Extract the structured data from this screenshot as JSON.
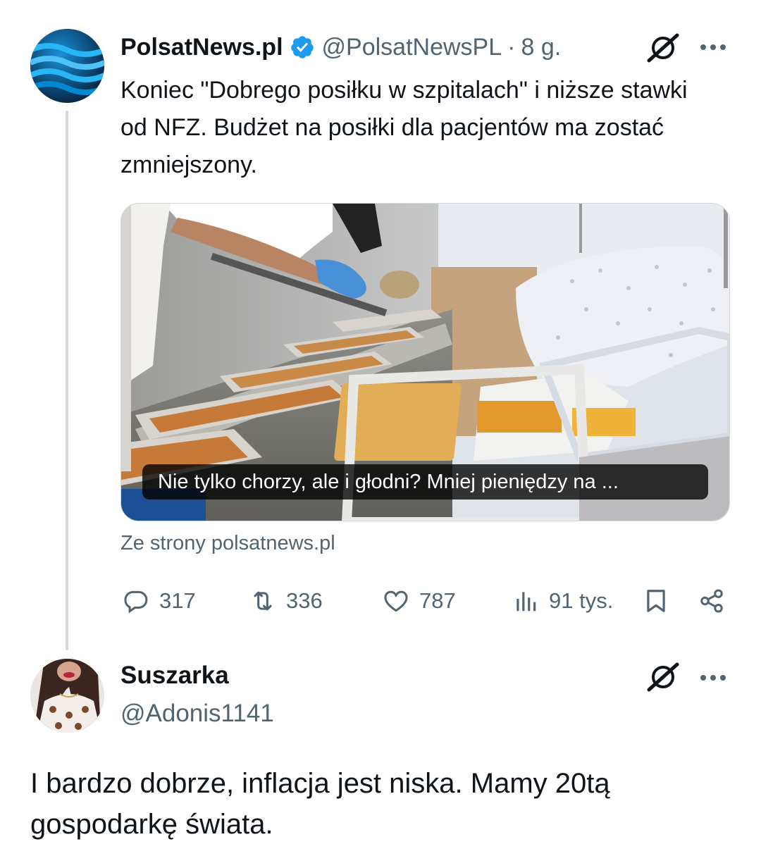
{
  "tweet": {
    "author_name": "PolsatNews.pl",
    "author_handle": "@PolsatNewsPL",
    "separator": "·",
    "time": "8 g.",
    "text": "Koniec \"Dobrego posiłku w szpitalach\" i niższe stawki od NFZ. Budżet na posiłki dla pacjentów ma zostać zmniejszony.",
    "media_caption": "Nie tylko chorzy, ale i głodni? Mniej pieniędzy na ...",
    "source": "Ze strony polsatnews.pl",
    "stats": {
      "replies": "317",
      "reposts": "336",
      "likes": "787",
      "views": "91 tys."
    }
  },
  "reply": {
    "author_name": "Suszarka",
    "author_handle": "@Adonis1141",
    "text": "I bardzo dobrze, inflacja jest niska. Mamy 20tą gospodarkę świata."
  },
  "colors": {
    "text_primary": "#0f1419",
    "text_secondary": "#536471",
    "verified_blue": "#1d9bf0",
    "thread_line": "#cfd9de"
  },
  "icons": {
    "verified": "verified-badge-icon",
    "grok": "grok-icon",
    "more": "more-dots-icon",
    "reply": "reply-icon",
    "repost": "repost-icon",
    "like": "heart-icon",
    "views": "views-chart-icon",
    "bookmark": "bookmark-icon",
    "share": "share-icon"
  }
}
